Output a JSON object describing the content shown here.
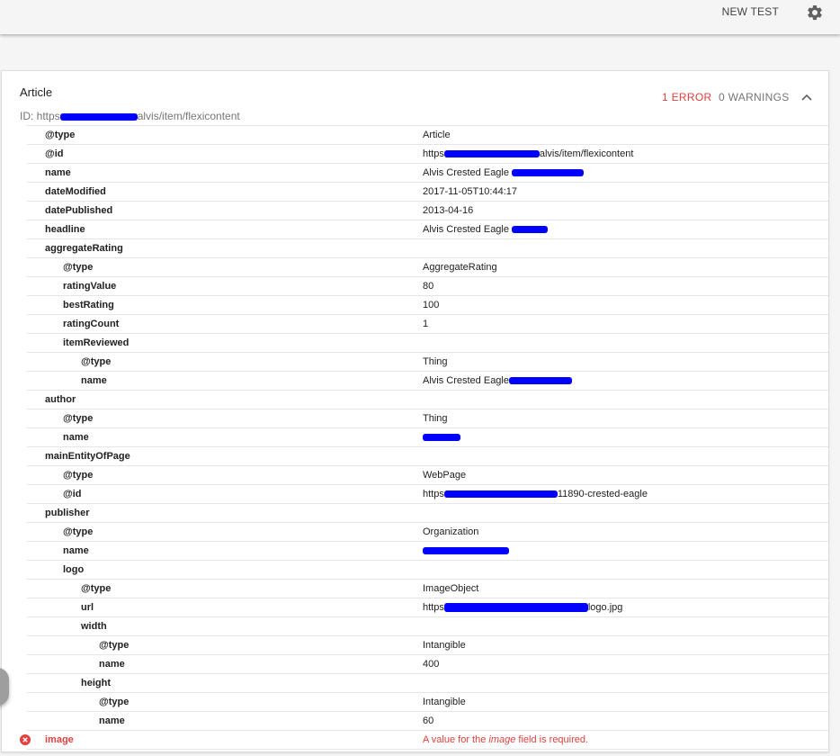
{
  "toolbar": {
    "new_test": "NEW TEST",
    "settings_icon": "gear-icon"
  },
  "card": {
    "title": "Article",
    "id_prefix": "ID: https",
    "id_suffix": "alvis/item/flexicontent",
    "errors": "1 ERROR",
    "warnings": "0 WARNINGS",
    "collapse_icon": "chevron-up-icon"
  },
  "rows": [
    {
      "key": "@type",
      "value": "Article"
    },
    {
      "key": "@id",
      "value": "https",
      "value_suffix": "alvis/item/flexicontent"
    },
    {
      "key": "name",
      "value": "Alvis Crested Eagle"
    },
    {
      "key": "dateModified",
      "value": "2017-11-05T10:44:17"
    },
    {
      "key": "datePublished",
      "value": "2013-04-16"
    },
    {
      "key": "headline",
      "value": "Alvis Crested Eagle"
    },
    {
      "key": "aggregateRating",
      "value": ""
    },
    {
      "key": "@type",
      "value": "AggregateRating"
    },
    {
      "key": "ratingValue",
      "value": "80"
    },
    {
      "key": "bestRating",
      "value": "100"
    },
    {
      "key": "ratingCount",
      "value": "1"
    },
    {
      "key": "itemReviewed",
      "value": ""
    },
    {
      "key": "@type",
      "value": "Thing"
    },
    {
      "key": "name",
      "value": "Alvis Crested Eagle"
    },
    {
      "key": "author",
      "value": ""
    },
    {
      "key": "@type",
      "value": "Thing"
    },
    {
      "key": "name",
      "value": ""
    },
    {
      "key": "mainEntityOfPage",
      "value": ""
    },
    {
      "key": "@type",
      "value": "WebPage"
    },
    {
      "key": "@id",
      "value": "https",
      "value_suffix": "11890-crested-eagle"
    },
    {
      "key": "publisher",
      "value": ""
    },
    {
      "key": "@type",
      "value": "Organization"
    },
    {
      "key": "name",
      "value": ""
    },
    {
      "key": "logo",
      "value": ""
    },
    {
      "key": "@type",
      "value": "ImageObject"
    },
    {
      "key": "url",
      "value": "https",
      "value_suffix": "logo.jpg"
    },
    {
      "key": "width",
      "value": ""
    },
    {
      "key": "@type",
      "value": "Intangible"
    },
    {
      "key": "name",
      "value": "400"
    },
    {
      "key": "height",
      "value": ""
    },
    {
      "key": "@type",
      "value": "Intangible"
    },
    {
      "key": "name",
      "value": "60"
    },
    {
      "key": "image",
      "value_pre": "A value for the ",
      "value_field": "image",
      "value_post": " field is required."
    }
  ],
  "colors": {
    "error": "#e04040",
    "redaction": "#0000ff"
  }
}
